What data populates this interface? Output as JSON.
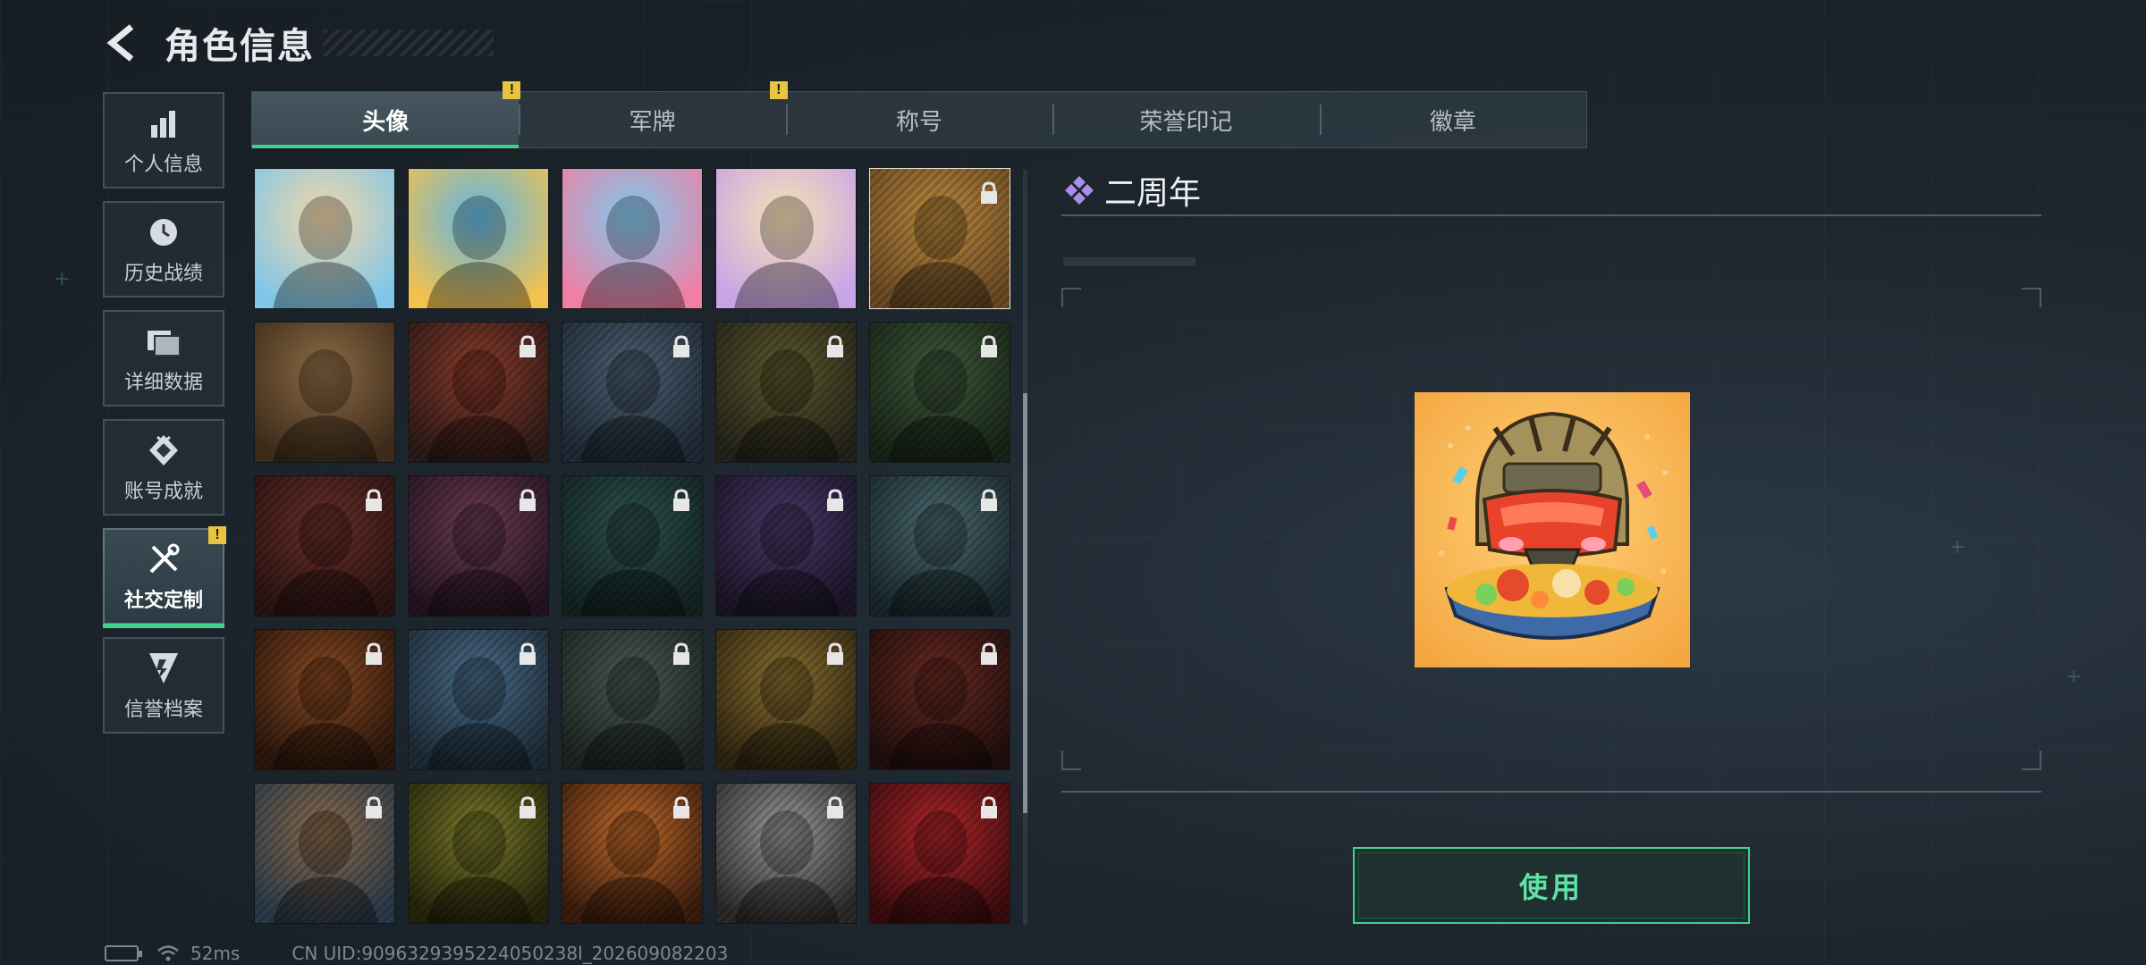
{
  "header": {
    "title": "角色信息"
  },
  "sidebar": {
    "items": [
      {
        "label": "个人信息",
        "icon": "bar-chart-icon",
        "active": false
      },
      {
        "label": "历史战绩",
        "icon": "history-clock-icon",
        "active": false
      },
      {
        "label": "详细数据",
        "icon": "folder-data-icon",
        "active": false
      },
      {
        "label": "账号成就",
        "icon": "achievement-medal-icon",
        "active": false
      },
      {
        "label": "社交定制",
        "icon": "tools-wrench-icon",
        "active": true,
        "alert": "!"
      },
      {
        "label": "信誉档案",
        "icon": "credit-shield-icon",
        "active": false
      }
    ]
  },
  "tabs": [
    {
      "label": "头像",
      "active": true,
      "alert": "!"
    },
    {
      "label": "军牌",
      "active": false,
      "alert": "!"
    },
    {
      "label": "称号",
      "active": false
    },
    {
      "label": "荣誉印记",
      "active": false
    },
    {
      "label": "徽章",
      "active": false
    }
  ],
  "avatars": [
    {
      "name": "avatar-anime-girl-sandcastle",
      "locked": false,
      "colors": [
        "#f4d7a8",
        "#7fc6e8"
      ]
    },
    {
      "name": "avatar-anime-boy-surfing",
      "locked": false,
      "colors": [
        "#5fb6e6",
        "#f2c14e"
      ]
    },
    {
      "name": "avatar-anime-boy-flamingo-float",
      "locked": false,
      "colors": [
        "#7ec9ee",
        "#f07fa2"
      ]
    },
    {
      "name": "avatar-anime-girl-white-hair",
      "locked": false,
      "colors": [
        "#f6e3b4",
        "#c7a3e8"
      ]
    },
    {
      "name": "avatar-soldier-hotpot",
      "locked": true,
      "selected": true,
      "colors": [
        "#b8873c",
        "#6b4a24"
      ]
    },
    {
      "name": "avatar-bearded-man-sepia",
      "locked": false,
      "colors": [
        "#8a6a44",
        "#3c2a1a"
      ]
    },
    {
      "name": "avatar-operator-cap-red",
      "locked": true,
      "colors": [
        "#8b3b2c",
        "#2b1a16"
      ]
    },
    {
      "name": "avatar-pilot-headset-blue",
      "locked": true,
      "colors": [
        "#4d6072",
        "#1e2a36"
      ]
    },
    {
      "name": "avatar-bald-operator-olive",
      "locked": true,
      "colors": [
        "#5d5a2c",
        "#24231a"
      ]
    },
    {
      "name": "avatar-operator-headset-green",
      "locked": true,
      "colors": [
        "#3f5a3c",
        "#172416"
      ]
    },
    {
      "name": "avatar-helmet-goggles-red",
      "locked": true,
      "colors": [
        "#6b2e2a",
        "#2a1412"
      ]
    },
    {
      "name": "avatar-white-hair-woman-pink",
      "locked": true,
      "colors": [
        "#6d3b52",
        "#241420"
      ]
    },
    {
      "name": "avatar-glasses-man-teal",
      "locked": true,
      "colors": [
        "#2d5250",
        "#122220"
      ]
    },
    {
      "name": "avatar-woman-bubblegum-purple",
      "locked": true,
      "colors": [
        "#4a3a6a",
        "#1a1426"
      ]
    },
    {
      "name": "avatar-masked-soldier-teal",
      "locked": true,
      "colors": [
        "#4a6a70",
        "#18262a"
      ]
    },
    {
      "name": "avatar-masked-man-orange",
      "locked": true,
      "colors": [
        "#8a4a22",
        "#2a160c"
      ]
    },
    {
      "name": "avatar-star-emblem-blue",
      "locked": true,
      "colors": [
        "#4a6c88",
        "#1c2a36"
      ]
    },
    {
      "name": "avatar-battlefield-helicopter",
      "locked": true,
      "colors": [
        "#4a5a52",
        "#1c2420"
      ]
    },
    {
      "name": "avatar-soldier-hotpot-yellow",
      "locked": true,
      "colors": [
        "#8a7030",
        "#2e2410"
      ]
    },
    {
      "name": "avatar-redhead-woman",
      "locked": true,
      "colors": [
        "#6a2a22",
        "#1e0e0c"
      ]
    },
    {
      "name": "avatar-eri-globe-emblem",
      "locked": true,
      "colors": [
        "#8a6a4a",
        "#2a3a4a"
      ]
    },
    {
      "name": "avatar-glasses-man-yellow",
      "locked": true,
      "colors": [
        "#7a7a2a",
        "#24240c"
      ]
    },
    {
      "name": "avatar-explosion-fire",
      "locked": true,
      "colors": [
        "#c06a2a",
        "#3a1c0c"
      ]
    },
    {
      "name": "avatar-soldier-pistol-bw",
      "locked": true,
      "colors": [
        "#9a9a9a",
        "#2a2a2a"
      ]
    },
    {
      "name": "avatar-shield-emblem-red",
      "locked": true,
      "colors": [
        "#b0262a",
        "#3a0c0e"
      ]
    }
  ],
  "detail": {
    "name": "二周年",
    "sub": "",
    "rarity_color": "#a98de6"
  },
  "use_button": {
    "label": "使用"
  },
  "status": {
    "ping": "52ms",
    "uid": "CN UID:9096329395224050238l_202609082203"
  },
  "colors": {
    "accent": "#3fd28c",
    "alert": "#e8c441",
    "selected_outline": "#e8e3d6"
  }
}
